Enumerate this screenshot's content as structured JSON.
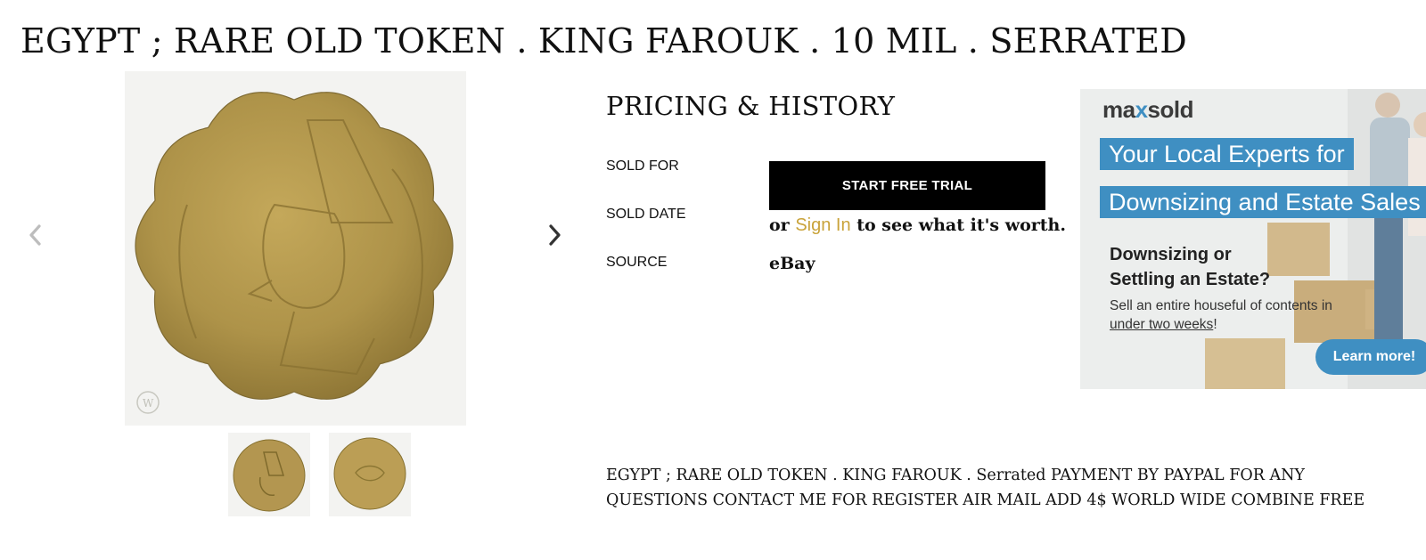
{
  "page": {
    "title": "EGYPT ; RARE OLD TOKEN . KING FAROUK . 10 MIL . SERRATED"
  },
  "pricing": {
    "heading": "PRICING & HISTORY",
    "labels": {
      "sold_for": "SOLD FOR",
      "sold_date": "SOLD DATE",
      "source": "SOURCE"
    },
    "trial_button": "START FREE TRIAL",
    "signin_prefix": "or ",
    "signin_link": "Sign In",
    "signin_suffix": " to see what it's worth.",
    "source_value": "eBay"
  },
  "ad": {
    "logo_prefix": "ma",
    "logo_x": "x",
    "logo_suffix": "sold",
    "line1": "Your Local Experts for",
    "line2": "Downsizing and Estate Sales",
    "subheading": "Downsizing or Settling an Estate?",
    "body_prefix": "Sell an entire houseful of contents in ",
    "body_underlined": "under two weeks",
    "body_suffix": "!",
    "cta": "Learn more!"
  },
  "description": "EGYPT ; RARE OLD TOKEN . KING FAROUK . Serrated PAYMENT BY PAYPAL FOR ANY QUESTIONS CONTACT ME FOR REGISTER AIR MAIL ADD 4$ WORLD WIDE COMBINE FREE",
  "colors": {
    "accent_gold": "#c9a33a",
    "button_black": "#000000",
    "ad_blue": "#3f8fc2",
    "coin_brass": "#b89a4e"
  },
  "icons": {
    "prev": "chevron-left-icon",
    "next": "chevron-right-icon"
  }
}
